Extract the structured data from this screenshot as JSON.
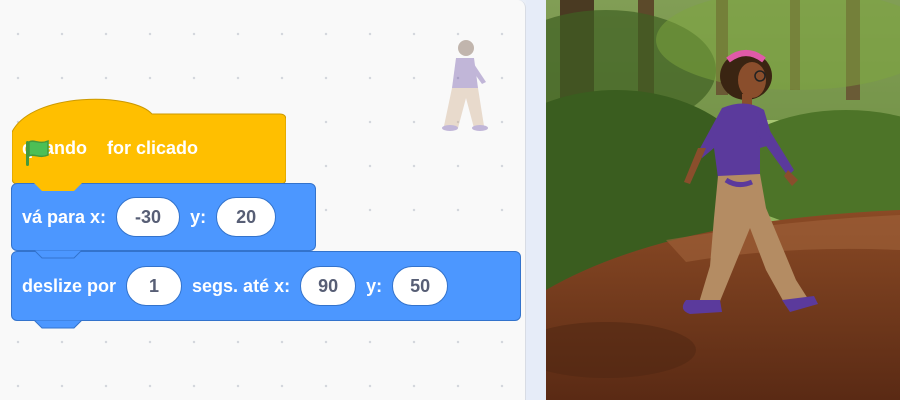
{
  "script": {
    "hat_label_1": "quando",
    "hat_label_2": "for clicado",
    "goto_label": "vá para x:",
    "goto_x": "-30",
    "goto_y_label": "y:",
    "goto_y": "20",
    "glide_label": "deslize por",
    "glide_secs": "1",
    "glide_secs_label": "segs. até x:",
    "glide_x": "90",
    "glide_y_label": "y:",
    "glide_y": "50"
  },
  "colors": {
    "events": "#ffbf00",
    "motion": "#4c97ff",
    "flag": "#4cbf56"
  },
  "icons": [
    "green-flag-icon"
  ],
  "stage": {
    "backdrop": "forest-path",
    "sprite": "walking-girl"
  }
}
